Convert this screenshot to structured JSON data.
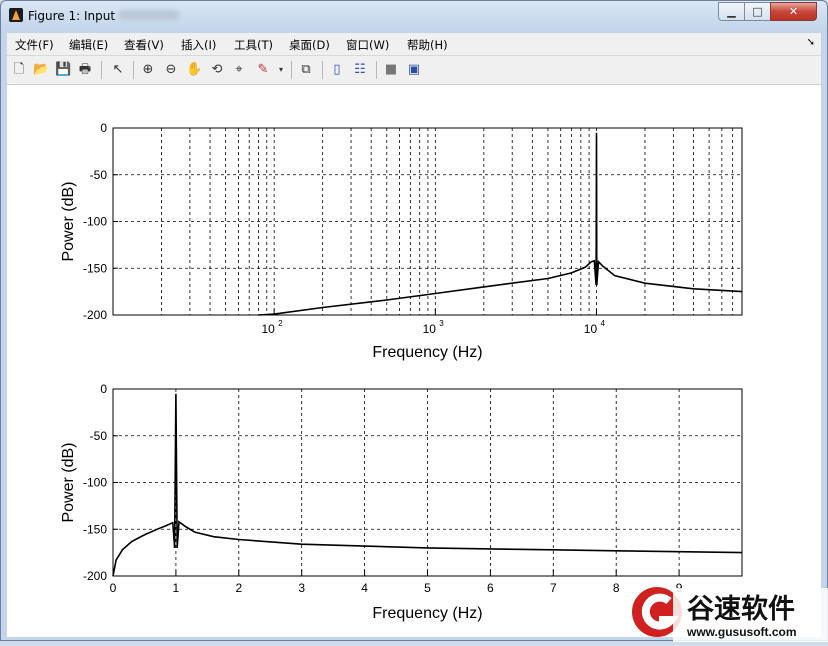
{
  "window": {
    "title": "Figure 1: Input",
    "subtitle_blurred": "Output"
  },
  "menu": [
    "文件(F)",
    "编辑(E)",
    "查看(V)",
    "插入(I)",
    "工具(T)",
    "桌面(D)",
    "窗口(W)",
    "帮助(H)"
  ],
  "toolbar": [
    "new-figure-icon",
    "open-icon",
    "save-icon",
    "print-icon",
    "pointer-icon",
    "zoom-in-icon",
    "zoom-out-icon",
    "pan-icon",
    "rotate-icon",
    "data-cursor-icon",
    "brush-icon",
    "link-plot-icon",
    "colorbar-icon",
    "legend-icon",
    "hide-plot-tools-icon",
    "show-plot-tools-icon"
  ],
  "watermark": {
    "brand": "谷速软件",
    "url": "www.gususoft.com"
  },
  "chart_data": [
    {
      "type": "line",
      "title": "",
      "xlabel": "Frequency (Hz)",
      "ylabel": "Power (dB)",
      "xscale": "log",
      "xlim": [
        10,
        80000
      ],
      "ylim": [
        -200,
        0
      ],
      "yticks": [
        "0",
        "-50",
        "-100",
        "-150",
        "-200"
      ],
      "xticks": [
        "10^2",
        "10^3",
        "10^4"
      ],
      "grid": true,
      "series": [
        {
          "x": [
            80,
            100,
            200,
            500,
            1000,
            2000,
            5000,
            7000,
            8500,
            9300,
            9700,
            9950,
            10000,
            10050,
            10300,
            11000,
            13000,
            20000,
            40000,
            80000
          ],
          "y": [
            -202,
            -199,
            -192,
            -184,
            -177,
            -170,
            -161,
            -155,
            -149,
            -143,
            -142,
            -168,
            -5,
            -168,
            -143,
            -148,
            -158,
            -166,
            -172,
            -175
          ]
        }
      ]
    },
    {
      "type": "line",
      "title": "",
      "xlabel": "Frequency (Hz)",
      "ylabel": "Power (dB)",
      "xlim": [
        0,
        10
      ],
      "ylim": [
        -200,
        0
      ],
      "xticks": [
        "0",
        "1",
        "2",
        "3",
        "4",
        "5",
        "6",
        "7",
        "8",
        "9"
      ],
      "yticks": [
        "0",
        "-50",
        "-100",
        "-150",
        "-200"
      ],
      "grid": true,
      "series": [
        {
          "x": [
            0,
            0.05,
            0.15,
            0.3,
            0.5,
            0.7,
            0.85,
            0.95,
            0.98,
            1.0,
            1.02,
            1.05,
            1.15,
            1.3,
            1.6,
            2,
            3,
            4,
            5,
            6,
            7,
            8,
            9,
            10
          ],
          "y": [
            -200,
            -183,
            -172,
            -163,
            -156,
            -150,
            -146,
            -143,
            -170,
            -5,
            -170,
            -142,
            -147,
            -153,
            -158,
            -161,
            -166,
            -168,
            -170,
            -171,
            -172,
            -173,
            -174,
            -175
          ]
        }
      ]
    }
  ]
}
